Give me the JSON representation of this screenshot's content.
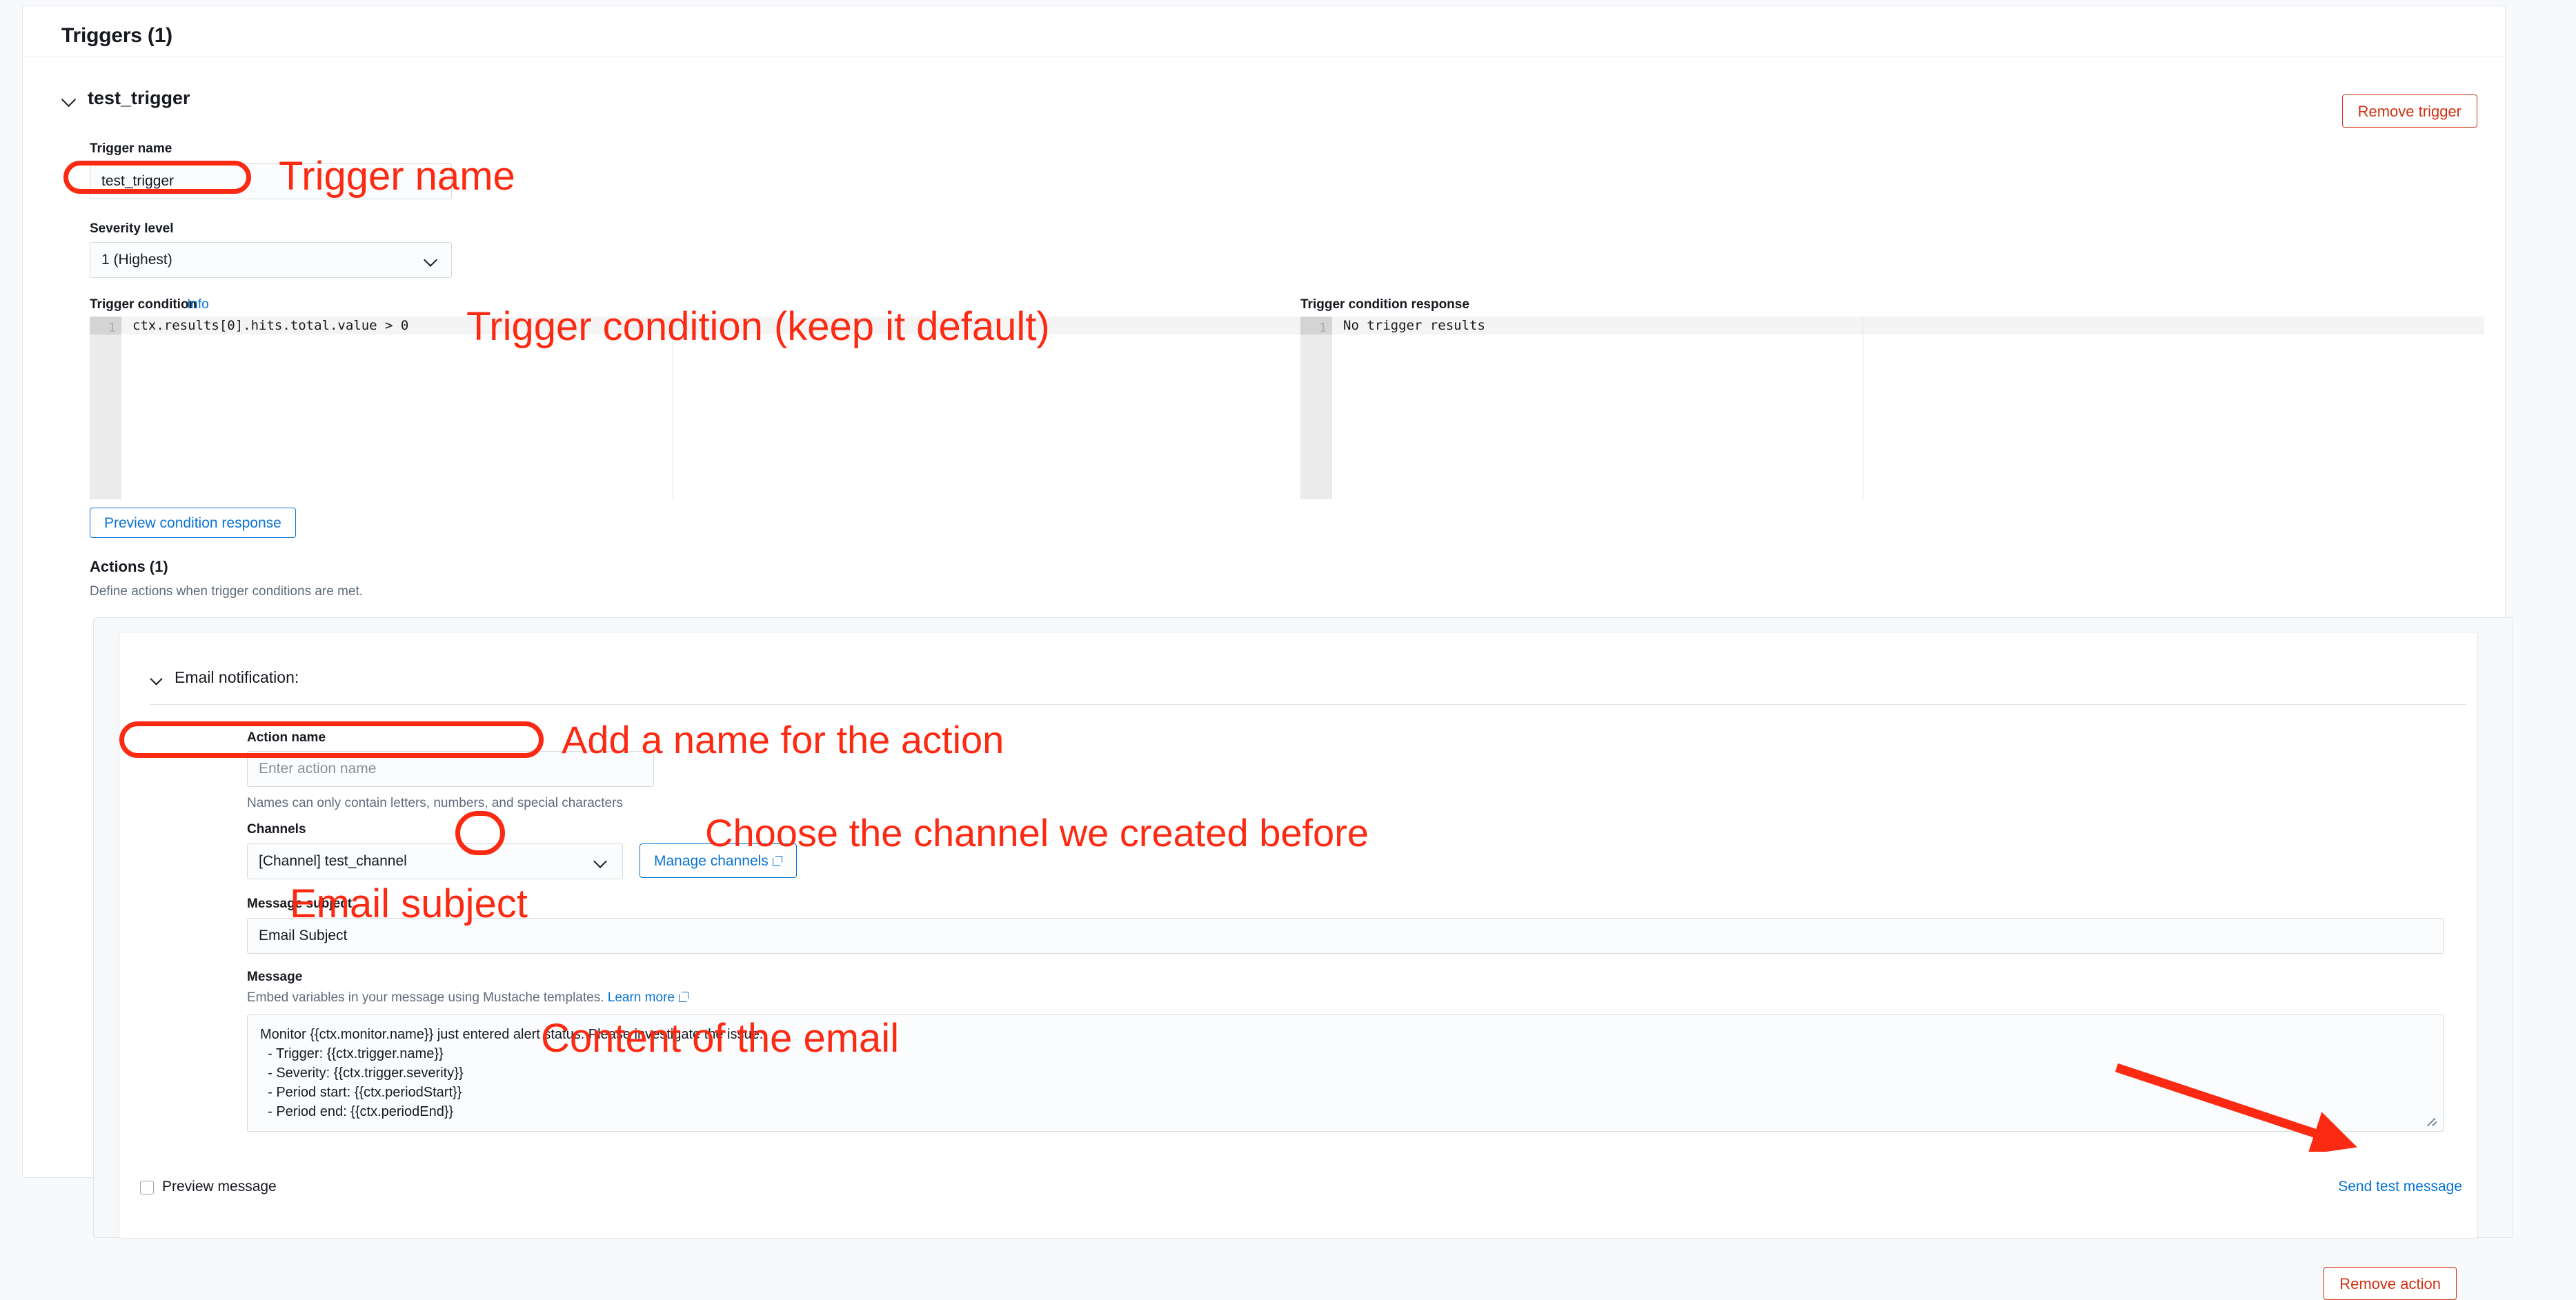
{
  "header": {
    "title": "Triggers (1)"
  },
  "trigger": {
    "name_heading": "test_trigger",
    "remove_label": "Remove trigger",
    "name_field": {
      "label": "Trigger name",
      "value": "test_trigger"
    },
    "severity_field": {
      "label": "Severity level",
      "value": "1 (Highest)"
    },
    "condition": {
      "label": "Trigger condition",
      "info_link": "Info",
      "line_number": "1",
      "code": "ctx.results[0].hits.total.value > 0"
    },
    "condition_response": {
      "label": "Trigger condition response",
      "line_number": "1",
      "code": "No trigger results"
    },
    "preview_button": "Preview condition response"
  },
  "actions": {
    "title": "Actions (1)",
    "subtitle": "Define actions when trigger conditions are met.",
    "remove_label": "Remove action",
    "action_title": "Email notification:",
    "action_name": {
      "label": "Action name",
      "placeholder": "Enter action name",
      "hint": "Names can only contain letters, numbers, and special characters"
    },
    "channels": {
      "label": "Channels",
      "value": "[Channel] test_channel",
      "manage_label": "Manage channels"
    },
    "message_subject": {
      "label": "Message subject",
      "value": "Email Subject"
    },
    "message": {
      "label": "Message",
      "hint_prefix": "Embed variables in your message using Mustache templates.",
      "hint_link": "Learn more",
      "body": "Monitor {{ctx.monitor.name}} just entered alert status. Please investigate the issue.\n  - Trigger: {{ctx.trigger.name}}\n  - Severity: {{ctx.trigger.severity}}\n  - Period start: {{ctx.periodStart}}\n  - Period end: {{ctx.periodEnd}}"
    },
    "preview_checkbox_label": "Preview message",
    "send_test_label": "Send test message"
  },
  "annotations": {
    "trigger_name": "Trigger name",
    "trigger_condition": "Trigger condition (keep it default)",
    "action_name": "Add a name for the action",
    "channel": "Choose the channel we created before",
    "email_subject": "Email subject",
    "email_content": "Content of the email"
  },
  "colors": {
    "annotation_red": "#fc2a12",
    "link_blue": "#0972d3",
    "danger_red": "#d13212"
  }
}
